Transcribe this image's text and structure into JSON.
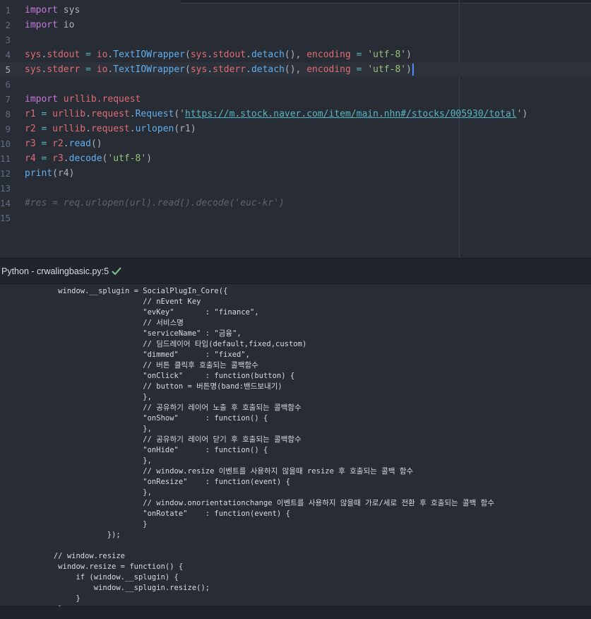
{
  "editor": {
    "lines": [
      {
        "num": "1",
        "tokens": [
          {
            "t": "import",
            "c": "kw"
          },
          {
            "t": " sys",
            "c": "p"
          }
        ]
      },
      {
        "num": "2",
        "tokens": [
          {
            "t": "import",
            "c": "kw"
          },
          {
            "t": " io",
            "c": "p"
          }
        ]
      },
      {
        "num": "3",
        "tokens": []
      },
      {
        "num": "4",
        "tokens": [
          {
            "t": "sys",
            "c": "var"
          },
          {
            "t": ".",
            "c": "p"
          },
          {
            "t": "stdout",
            "c": "attr"
          },
          {
            "t": " = ",
            "c": "op"
          },
          {
            "t": "io",
            "c": "var"
          },
          {
            "t": ".",
            "c": "p"
          },
          {
            "t": "TextIOWrapper",
            "c": "fn"
          },
          {
            "t": "(",
            "c": "p"
          },
          {
            "t": "sys",
            "c": "var"
          },
          {
            "t": ".",
            "c": "p"
          },
          {
            "t": "stdout",
            "c": "attr"
          },
          {
            "t": ".",
            "c": "p"
          },
          {
            "t": "detach",
            "c": "fn"
          },
          {
            "t": "(), ",
            "c": "p"
          },
          {
            "t": "encoding",
            "c": "attr"
          },
          {
            "t": " = ",
            "c": "op"
          },
          {
            "t": "'utf-8'",
            "c": "str"
          },
          {
            "t": ")",
            "c": "p"
          }
        ]
      },
      {
        "num": "5",
        "active": true,
        "cursor": true,
        "tokens": [
          {
            "t": "sys",
            "c": "var"
          },
          {
            "t": ".",
            "c": "p"
          },
          {
            "t": "stderr",
            "c": "attr"
          },
          {
            "t": " = ",
            "c": "op"
          },
          {
            "t": "io",
            "c": "var"
          },
          {
            "t": ".",
            "c": "p"
          },
          {
            "t": "TextIOWrapper",
            "c": "fn"
          },
          {
            "t": "(",
            "c": "p"
          },
          {
            "t": "sys",
            "c": "var"
          },
          {
            "t": ".",
            "c": "p"
          },
          {
            "t": "stderr",
            "c": "attr"
          },
          {
            "t": ".",
            "c": "p"
          },
          {
            "t": "detach",
            "c": "fn"
          },
          {
            "t": "(), ",
            "c": "p"
          },
          {
            "t": "encoding",
            "c": "attr"
          },
          {
            "t": " = ",
            "c": "op"
          },
          {
            "t": "'utf-8'",
            "c": "str"
          },
          {
            "t": ")",
            "c": "p"
          }
        ]
      },
      {
        "num": "6",
        "tokens": []
      },
      {
        "num": "7",
        "tokens": [
          {
            "t": "import",
            "c": "kw"
          },
          {
            "t": " urllib.request",
            "c": "var"
          }
        ]
      },
      {
        "num": "8",
        "tokens": [
          {
            "t": "r1",
            "c": "var"
          },
          {
            "t": " = ",
            "c": "op"
          },
          {
            "t": "urllib",
            "c": "var"
          },
          {
            "t": ".",
            "c": "p"
          },
          {
            "t": "request",
            "c": "var"
          },
          {
            "t": ".",
            "c": "p"
          },
          {
            "t": "Request",
            "c": "fn"
          },
          {
            "t": "(",
            "c": "p"
          },
          {
            "t": "'",
            "c": "str"
          },
          {
            "t": "https://m.stock.naver.com/item/main.nhn#/stocks/005930/total",
            "c": "url"
          },
          {
            "t": "'",
            "c": "str"
          },
          {
            "t": ")",
            "c": "p"
          }
        ]
      },
      {
        "num": "9",
        "tokens": [
          {
            "t": "r2",
            "c": "var"
          },
          {
            "t": " = ",
            "c": "op"
          },
          {
            "t": "urllib",
            "c": "var"
          },
          {
            "t": ".",
            "c": "p"
          },
          {
            "t": "request",
            "c": "var"
          },
          {
            "t": ".",
            "c": "p"
          },
          {
            "t": "urlopen",
            "c": "fn"
          },
          {
            "t": "(r1)",
            "c": "p"
          }
        ]
      },
      {
        "num": "10",
        "tokens": [
          {
            "t": "r3",
            "c": "var"
          },
          {
            "t": " = ",
            "c": "op"
          },
          {
            "t": "r2",
            "c": "var"
          },
          {
            "t": ".",
            "c": "p"
          },
          {
            "t": "read",
            "c": "fn"
          },
          {
            "t": "()",
            "c": "p"
          }
        ]
      },
      {
        "num": "11",
        "tokens": [
          {
            "t": "r4",
            "c": "var"
          },
          {
            "t": " = ",
            "c": "op"
          },
          {
            "t": "r3",
            "c": "var"
          },
          {
            "t": ".",
            "c": "p"
          },
          {
            "t": "decode",
            "c": "fn"
          },
          {
            "t": "(",
            "c": "p"
          },
          {
            "t": "'utf-8'",
            "c": "str"
          },
          {
            "t": ")",
            "c": "p"
          }
        ]
      },
      {
        "num": "12",
        "tokens": [
          {
            "t": "print",
            "c": "fn"
          },
          {
            "t": "(r4)",
            "c": "p"
          }
        ]
      },
      {
        "num": "13",
        "tokens": []
      },
      {
        "num": "14",
        "tokens": [
          {
            "t": "#res = req.urlopen(url).read().decode('euc-kr')",
            "c": "cm"
          }
        ]
      },
      {
        "num": "15",
        "tokens": []
      }
    ]
  },
  "panel": {
    "title": "Python - crwalingbasic.py:5",
    "status_icon": "check-icon",
    "status_color": "#73c990"
  },
  "output": {
    "lines": [
      "             window.__splugin = SocialPlugIn_Core({",
      "                                // nEvent Key",
      "                                \"evKey\"       : \"finance\",",
      "                                // 서비스명",
      "                                \"serviceName\" : \"금융\",",
      "                                // 딤드레이어 타입(default,fixed,custom)",
      "                                \"dimmed\"      : \"fixed\",",
      "                                // 버튼 클릭후 호출되는 콜백함수",
      "                                \"onClick\"     : function(button) {",
      "                                // button = 버튼명(band:밴드보내기)",
      "                                },",
      "                                // 공유하기 레이어 노출 후 호출되는 콜백함수",
      "                                \"onShow\"      : function() {",
      "                                },",
      "                                // 공유하기 레이어 닫기 후 호출되는 콜백함수",
      "                                \"onHide\"      : function() {",
      "                                },",
      "                                // window.resize 이벤트를 사용하지 않을때 resize 후 호출되는 콜백 함수",
      "                                \"onResize\"    : function(event) {",
      "                                },",
      "                                // window.onorientationchange 이벤트를 사용하지 않을때 가로/세로 전환 후 호출되는 콜백 함수",
      "                                \"onRotate\"    : function(event) {",
      "                                }",
      "                        });",
      "",
      "            // window.resize",
      "             window.resize = function() {",
      "                 if (window.__splugin) {",
      "                     window.__splugin.resize();",
      "                 }",
      "             }"
    ]
  }
}
